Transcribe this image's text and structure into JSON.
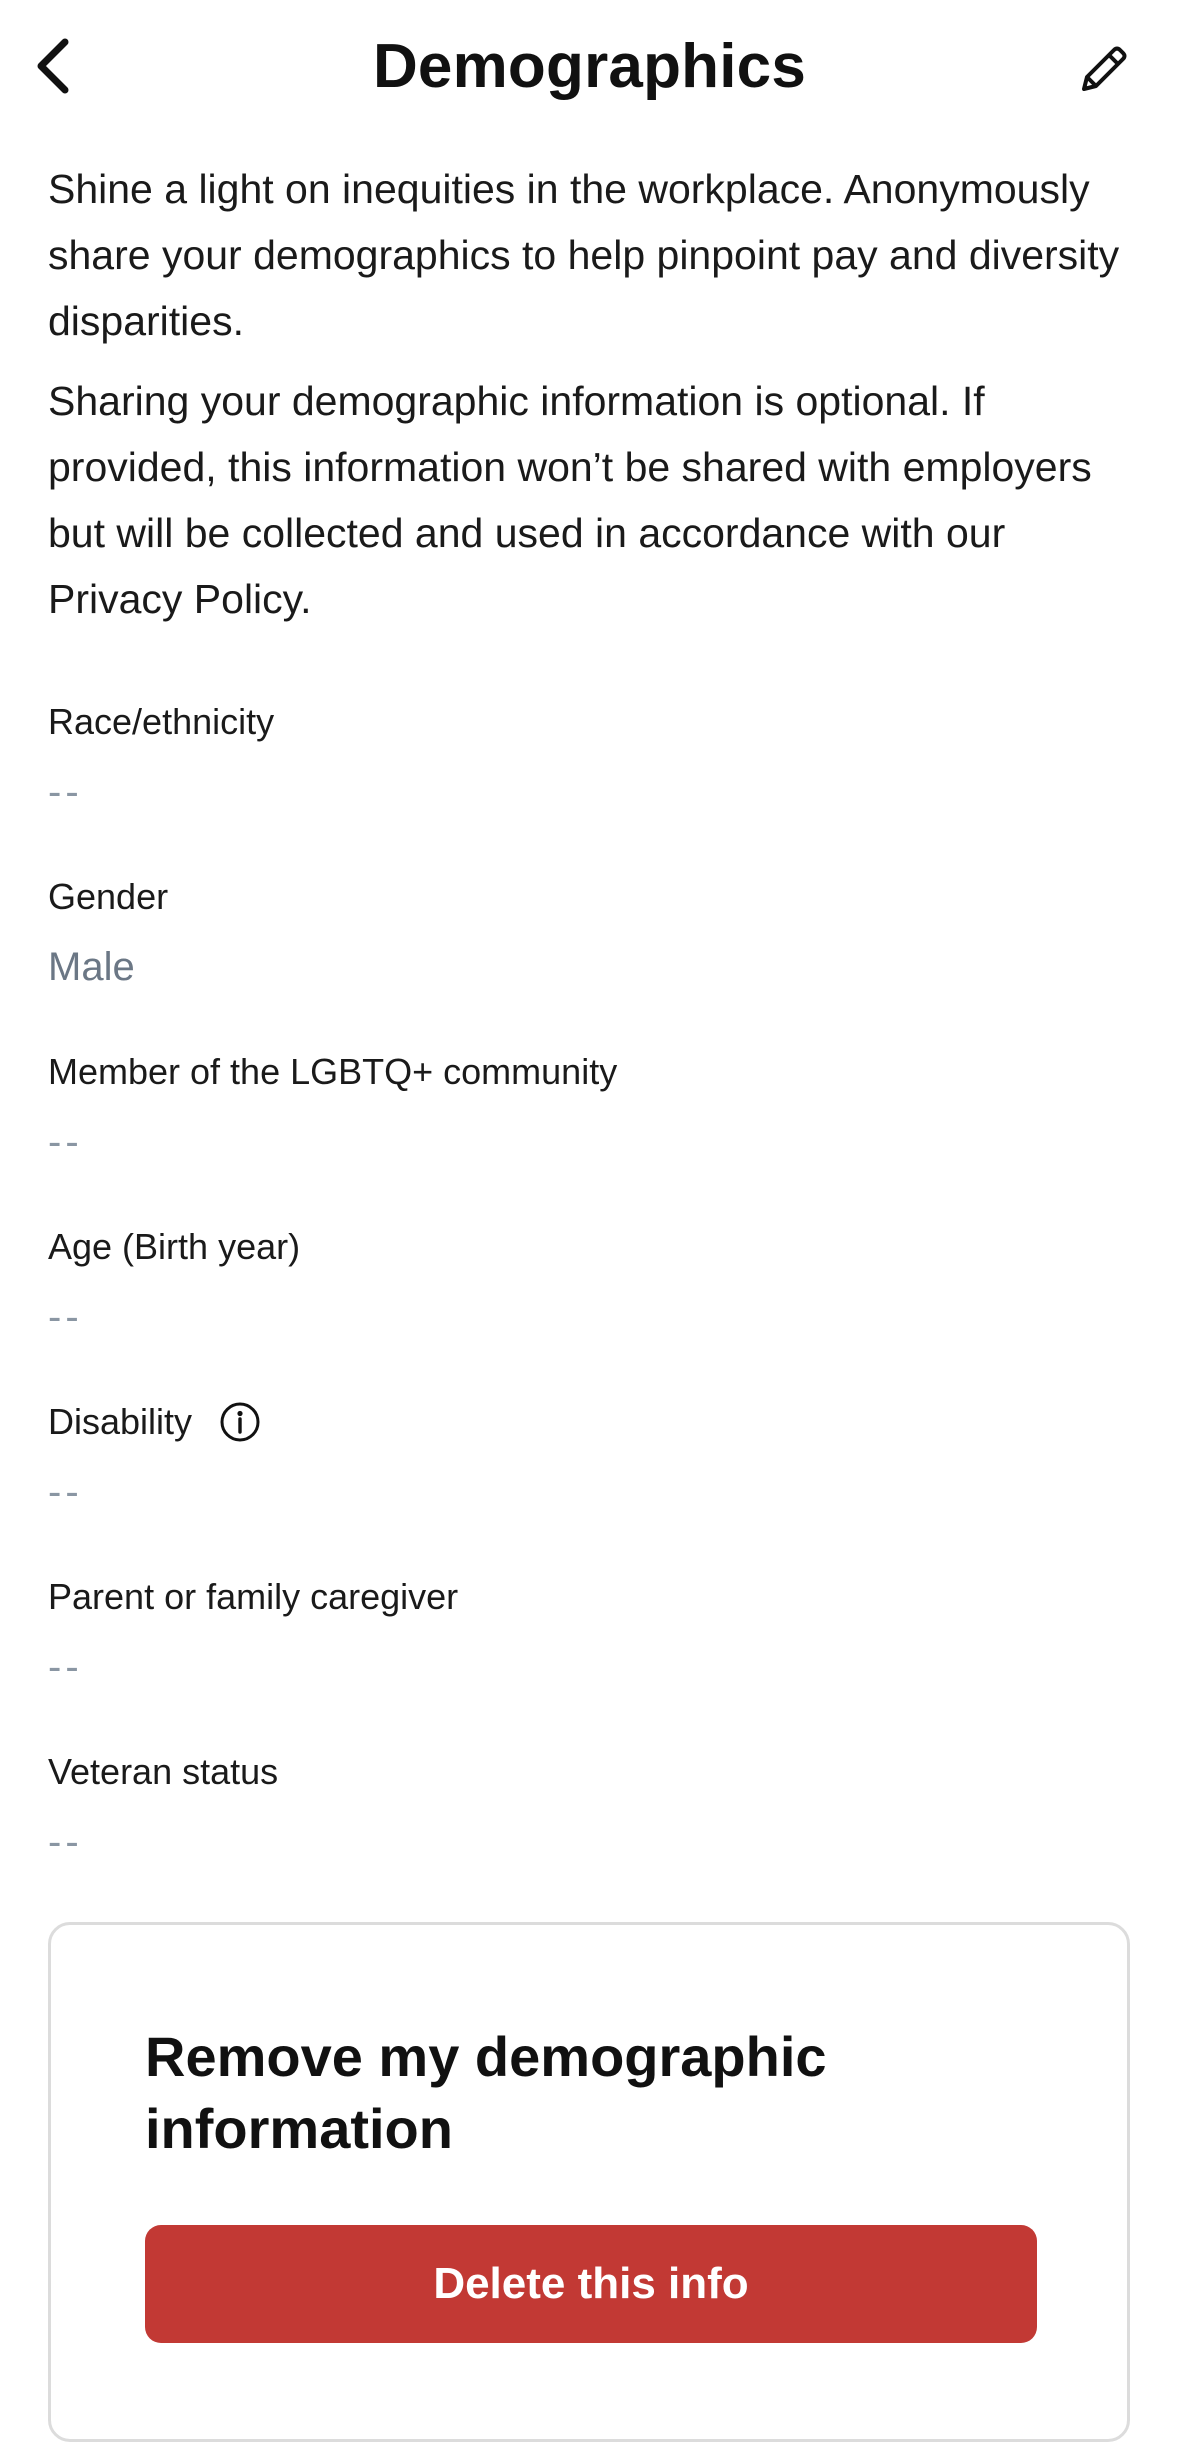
{
  "header": {
    "title": "Demographics",
    "back_icon": "chevron-left-icon",
    "edit_icon": "pencil-icon"
  },
  "intro": {
    "paragraph1": "Shine a light on inequities in the workplace. Anonymously share your demographics to help pinpoint pay and diversity disparities.",
    "paragraph2": "Sharing your demographic information is optional. If provided, this information won’t be shared with employers but will be collected and used in accordance with our Privacy Policy."
  },
  "fields": [
    {
      "label": "Race/ethnicity",
      "value": "--"
    },
    {
      "label": "Gender",
      "value": "Male"
    },
    {
      "label": "Member of the LGBTQ+ community",
      "value": "--"
    },
    {
      "label": "Age (Birth year)",
      "value": "--"
    },
    {
      "label": "Disability",
      "value": "--",
      "icon": "info-icon"
    },
    {
      "label": "Parent or family caregiver",
      "value": "--"
    },
    {
      "label": "Veteran status",
      "value": "--"
    }
  ],
  "remove_card": {
    "title": "Remove my demographic information",
    "button_label": "Delete this info"
  },
  "colors": {
    "danger": "#c23934",
    "value_text": "#6b7785",
    "card_border": "#dcdcdc"
  }
}
